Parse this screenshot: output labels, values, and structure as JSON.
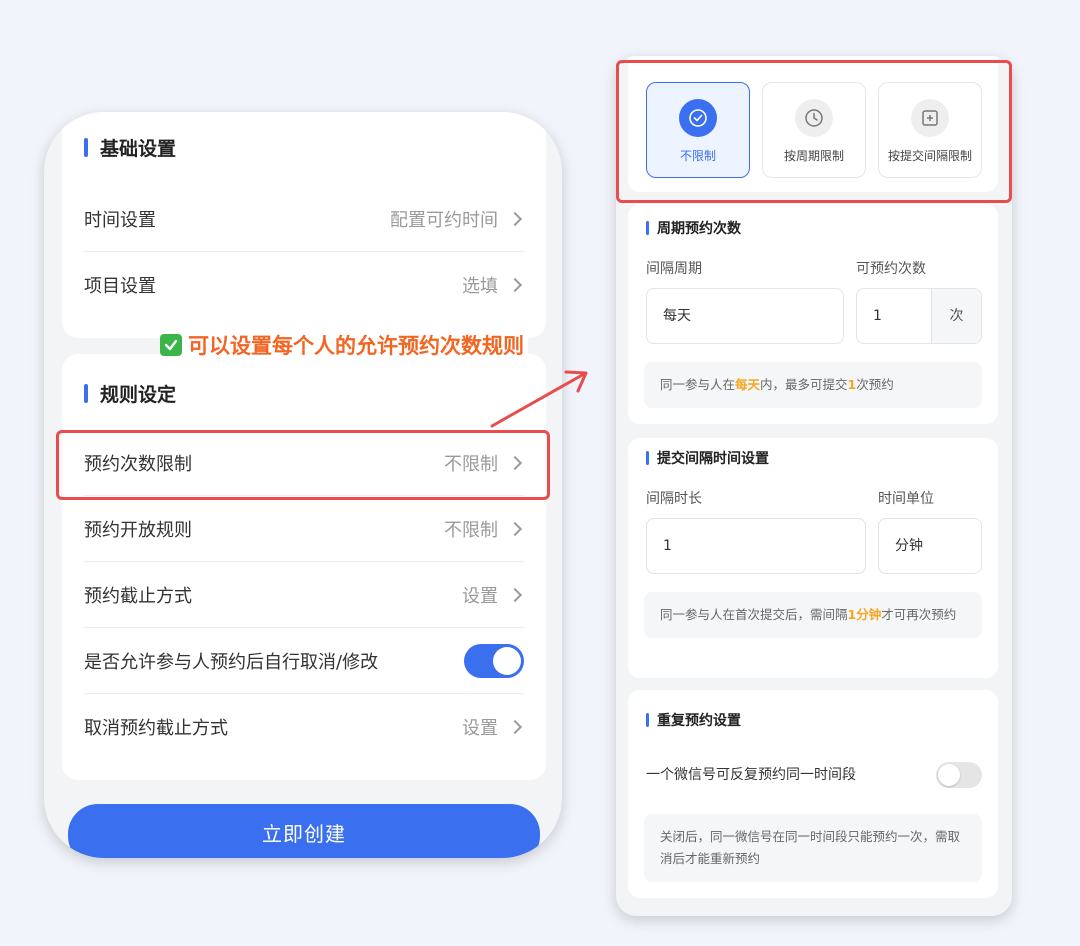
{
  "left": {
    "basic": {
      "title": "基础设置",
      "rows": [
        {
          "label": "时间设置",
          "value": "配置可约时间"
        },
        {
          "label": "项目设置",
          "value": "选填"
        }
      ]
    },
    "rules": {
      "title": "规则设定",
      "rows": [
        {
          "label": "预约次数限制",
          "value": "不限制"
        },
        {
          "label": "预约开放规则",
          "value": "不限制"
        },
        {
          "label": "预约截止方式",
          "value": "设置"
        },
        {
          "label": "是否允许参与人预约后自行取消/修改",
          "toggle": true
        },
        {
          "label": "取消预约截止方式",
          "value": "设置"
        }
      ]
    },
    "create_label": "立即创建"
  },
  "annotation": {
    "text": "可以设置每个人的允许预约次数规则"
  },
  "right": {
    "options": [
      {
        "label": "不限制",
        "icon": "check-circle-icon",
        "active": true
      },
      {
        "label": "按周期限制",
        "icon": "clock-icon",
        "active": false
      },
      {
        "label": "按提交间隔限制",
        "icon": "plus-square-icon",
        "active": false
      }
    ],
    "period": {
      "title": "周期预约次数",
      "interval_label": "间隔周期",
      "interval_value": "每天",
      "count_label": "可预约次数",
      "count_value": "1",
      "count_unit": "次",
      "note_pre": "同一参与人在",
      "note_em1": "每天",
      "note_mid": "内，最多可提交",
      "note_em2": "1",
      "note_post": "次预约"
    },
    "interval": {
      "title": "提交间隔时间设置",
      "duration_label": "间隔时长",
      "duration_value": "1",
      "unit_label": "时间单位",
      "unit_value": "分钟",
      "note_pre": "同一参与人在首次提交后，需间隔",
      "note_em": "1分钟",
      "note_post": "才可再次预约"
    },
    "repeat": {
      "title": "重复预约设置",
      "toggle_label": "一个微信号可反复预约同一时间段",
      "note": "关闭后，同一微信号在同一时间段只能预约一次，需取消后才能重新预约"
    }
  },
  "colors": {
    "accent": "#3a6ff0",
    "highlight": "#e84c4c",
    "annotation": "#f26522",
    "emphasis": "#f5a623"
  }
}
